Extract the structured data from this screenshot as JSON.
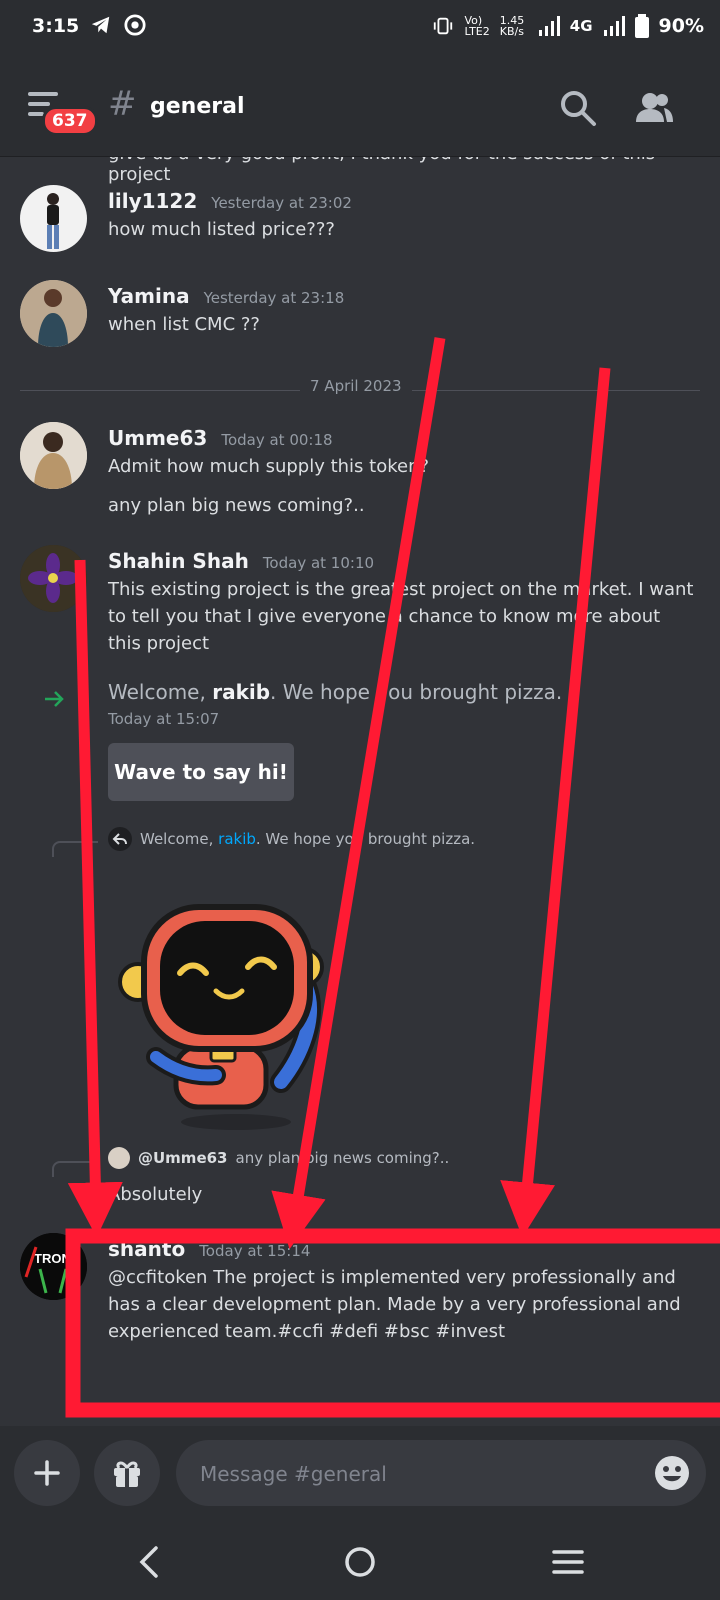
{
  "status_bar": {
    "time": "3:15",
    "network_text": "4G",
    "speed": "1.45\nKB/s",
    "battery": "90%"
  },
  "header": {
    "badge": "637",
    "channel": "general"
  },
  "partial_line": "give us a very good profit, I thank you for the success of this project",
  "messages": [
    {
      "username": "lily1122",
      "time": "Yesterday at 23:02",
      "lines": [
        "how much listed price???"
      ]
    },
    {
      "username": "Yamina",
      "time": "Yesterday at 23:18",
      "lines": [
        "when list CMC ??"
      ]
    },
    {
      "username": "Umme63",
      "time": "Today at 00:18",
      "lines": [
        "Admit how much supply this token?",
        "any plan big news coming?.."
      ]
    },
    {
      "username": "Shahin Shah",
      "time": "Today at 10:10",
      "lines": [
        "This existing project is the greatest project on the market.  I want to tell you that I give everyone a chance to know more about this project"
      ]
    },
    {
      "username": "shanto",
      "time": "Today at 15:14",
      "lines": [
        "@ccfitoken The project is implemented very professionally and has a clear development plan. Made by a very professional and experienced team.#ccfi #defi #bsc #invest"
      ]
    }
  ],
  "date_divider": "7 April 2023",
  "welcome": {
    "prefix": "Welcome, ",
    "name": "rakib",
    "suffix": ". We hope you brought pizza.",
    "time": "Today at 15:07",
    "wave_button": "Wave to say hi!"
  },
  "reply1": {
    "prefix": "Welcome, ",
    "name": "rakib",
    "suffix": ". We hope you brought pizza."
  },
  "reply2": {
    "mention": "@Umme63",
    "text": "any plan big news coming?.."
  },
  "absolutely": "Absolutely",
  "avatar_text": "TRON",
  "composer": {
    "placeholder": "Message #general"
  },
  "colors": {
    "background": "#313338",
    "bar": "#2b2d31",
    "badge": "#f23f43",
    "annotation": "#ff1a33",
    "link": "#00a8fc"
  }
}
